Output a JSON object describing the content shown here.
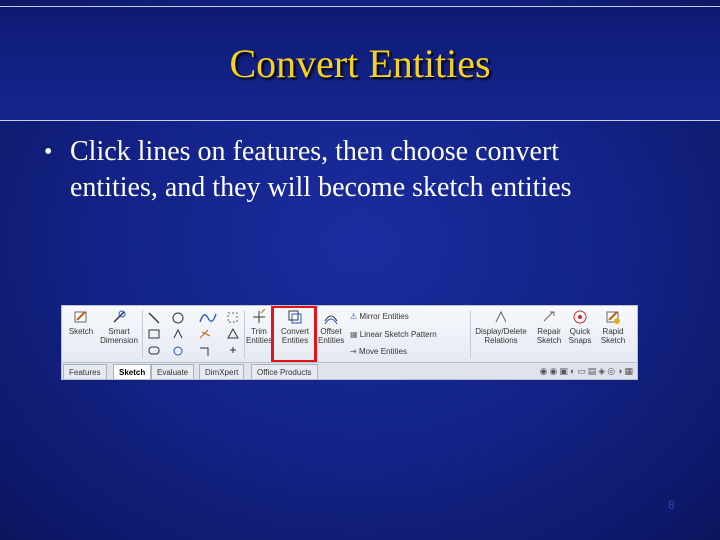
{
  "slide": {
    "title": "Convert Entities",
    "bullet": "Click lines on features, then choose convert entities, and they will become sketch entities",
    "page_number": "8"
  },
  "ribbon": {
    "sketch_label": "Sketch",
    "smart_dim_label": "Smart\nDimension",
    "trim_label": "Trim\nEntities",
    "convert_label": "Convert\nEntities",
    "offset_label": "Offset\nEntities",
    "mirror_label": "Mirror Entities",
    "linear_label": "Linear Sketch Pattern",
    "move_label": "Move Entities",
    "display_label": "Display/Delete\nRelations",
    "repair_label": "Repair\nSketch",
    "quick_label": "Quick\nSnaps",
    "rapid_label": "Rapid\nSketch",
    "tabs": [
      "Features",
      "Sketch",
      "Evaluate",
      "DimXpert",
      "Office Products"
    ],
    "active_tab": "Sketch",
    "highlight_color": "#e2141a"
  }
}
